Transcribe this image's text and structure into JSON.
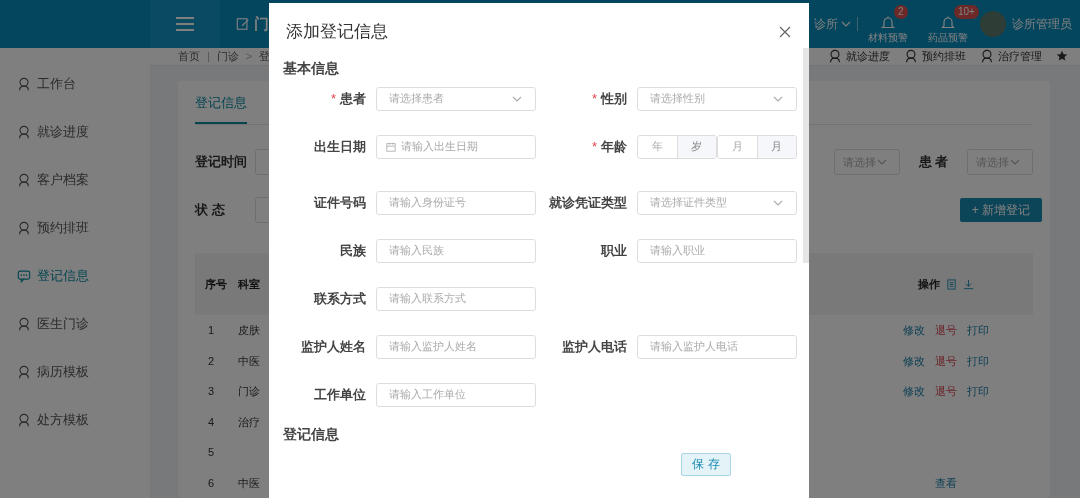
{
  "header": {
    "module": "门",
    "clinic": "诊所",
    "alerts": [
      {
        "label": "材料预警",
        "count": "2"
      },
      {
        "label": "药品预警",
        "count": "10+"
      }
    ],
    "user": "诊所管理员"
  },
  "sidebar": {
    "items": [
      {
        "label": "工作台",
        "selected": false
      },
      {
        "label": "就诊进度",
        "selected": false
      },
      {
        "label": "客户档案",
        "selected": false
      },
      {
        "label": "预约排班",
        "selected": false
      },
      {
        "label": "登记信息",
        "selected": true
      },
      {
        "label": "医生门诊",
        "selected": false
      },
      {
        "label": "病历模板",
        "selected": false
      },
      {
        "label": "处方模板",
        "selected": false
      }
    ]
  },
  "breadcrumb": [
    "首页",
    "门诊",
    "登"
  ],
  "breadcrumb_separators": [
    "|",
    ">"
  ],
  "quick_links": [
    "就诊进度",
    "预约排班",
    "治疗管理"
  ],
  "tabs": [
    {
      "label": "登记信息",
      "selected": true
    }
  ],
  "filters": {
    "time_label": "登记时间",
    "status_label": "状 态",
    "select_placeholder": "请选择",
    "patient_label": "患 者",
    "patient_placeholder": "请选择"
  },
  "add_button": "+ 新增登记",
  "table": {
    "columns": [
      "序号",
      "科室",
      "操作"
    ],
    "rows": [
      {
        "index": "1",
        "dept": "皮肤",
        "actions": [
          "修改",
          "退号",
          "打印"
        ]
      },
      {
        "index": "2",
        "dept": "中医",
        "actions": [
          "修改",
          "退号",
          "打印"
        ]
      },
      {
        "index": "3",
        "dept": "门诊",
        "actions": [
          "修改",
          "退号",
          "打印"
        ]
      },
      {
        "index": "4",
        "dept": "治疗",
        "actions": []
      },
      {
        "index": "5",
        "dept": "",
        "actions": []
      },
      {
        "index": "6",
        "dept": "中医",
        "actions": [
          "查看"
        ]
      }
    ]
  },
  "dialog": {
    "title": "添加登记信息",
    "required_mark": "*",
    "sections": [
      {
        "title": "基本信息"
      },
      {
        "title": "登记信息"
      }
    ],
    "rows": [
      {
        "fields": [
          {
            "label": "患者",
            "required": true,
            "kind": "select",
            "placeholder": "请选择患者"
          },
          {
            "label": "性别",
            "required": true,
            "kind": "select",
            "placeholder": "请选择性别"
          }
        ]
      },
      {
        "fields": [
          {
            "label": "出生日期",
            "required": false,
            "kind": "date",
            "placeholder": "请输入出生日期"
          },
          {
            "label": "年龄",
            "required": true,
            "kind": "age",
            "parts": [
              {
                "placeholder": "年",
                "unit": "岁"
              },
              {
                "placeholder": "月",
                "unit": "月"
              }
            ]
          }
        ]
      },
      {
        "fields": [
          {
            "label": "证件号码",
            "required": false,
            "kind": "input",
            "placeholder": "请输入身份证号"
          },
          {
            "label": "就诊凭证类型",
            "required": false,
            "kind": "select",
            "placeholder": "请选择证件类型"
          }
        ]
      },
      {
        "fields": [
          {
            "label": "民族",
            "required": false,
            "kind": "input",
            "placeholder": "请输入民族"
          },
          {
            "label": "职业",
            "required": false,
            "kind": "input",
            "placeholder": "请输入职业"
          }
        ]
      },
      {
        "fields": [
          {
            "label": "联系方式",
            "required": false,
            "kind": "input",
            "placeholder": "请输入联系方式"
          }
        ]
      },
      {
        "fields": [
          {
            "label": "监护人姓名",
            "required": false,
            "kind": "input",
            "placeholder": "请输入监护人姓名"
          },
          {
            "label": "监护人电话",
            "required": false,
            "kind": "input",
            "placeholder": "请输入监护人电话"
          }
        ]
      },
      {
        "fields": [
          {
            "label": "工作单位",
            "required": false,
            "kind": "input",
            "placeholder": "请输入工作单位"
          }
        ]
      }
    ],
    "save_button": "保 存"
  }
}
